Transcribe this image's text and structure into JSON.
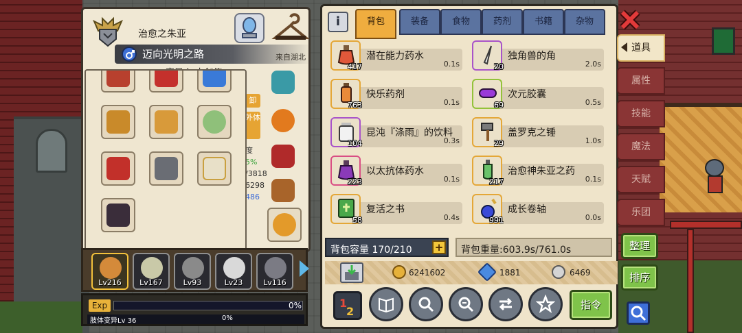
{
  "character": {
    "name": "治愈之朱亚",
    "title": "迈向光明之路",
    "origin": "来自湖北",
    "subtitle": "变异人 大剑使"
  },
  "stats_peek": {
    "btn1": "卸",
    "btn2": "外体",
    "lines": [
      "度",
      "5%",
      "/3818",
      "6298",
      "486"
    ]
  },
  "heroes": [
    {
      "level": "Lv216",
      "color": "#d48a3a"
    },
    {
      "level": "Lv167",
      "color": "#c9c9a8"
    },
    {
      "level": "Lv93",
      "color": "#8a8a8a"
    },
    {
      "level": "Lv23",
      "color": "#d9d9d9"
    },
    {
      "level": "Lv116",
      "color": "#7b7b84"
    }
  ],
  "exp": {
    "tag": "Exp",
    "percent": "0%",
    "sub_label": "肢体变异Lv 36",
    "sub_percent": "0%",
    "fill": 0
  },
  "tabs": [
    "背包",
    "装备",
    "食物",
    "药剂",
    "书籍",
    "杂物"
  ],
  "active_tab": "背包",
  "items": [
    {
      "name": "潜在能力药水",
      "count": "417",
      "time": "0.1s",
      "frame": "orange",
      "icon": "potion-orange-icon"
    },
    {
      "name": "独角兽的角",
      "count": "20",
      "time": "2.0s",
      "frame": "purple",
      "icon": "unicorn-horn-icon"
    },
    {
      "name": "快乐药剂",
      "count": "763",
      "time": "0.1s",
      "frame": "orange",
      "icon": "potion-bottle-icon"
    },
    {
      "name": "次元胶囊",
      "count": "69",
      "time": "0.5s",
      "frame": "green",
      "icon": "capsule-icon"
    },
    {
      "name": "昆沌『涤雨』的饮料",
      "count": "104",
      "time": "0.3s",
      "frame": "purple",
      "icon": "drink-jar-icon"
    },
    {
      "name": "盖罗克之锤",
      "count": "29",
      "time": "1.0s",
      "frame": "orange",
      "icon": "hammer-icon"
    },
    {
      "name": "以太抗体药水",
      "count": "223",
      "time": "0.1s",
      "frame": "pink",
      "icon": "potion-purple-icon"
    },
    {
      "name": "治愈神朱亚之药",
      "count": "217",
      "time": "0.1s",
      "frame": "orange",
      "icon": "potion-green-icon"
    },
    {
      "name": "复活之书",
      "count": "58",
      "time": "0.4s",
      "frame": "orange",
      "icon": "book-icon"
    },
    {
      "name": "成长卷轴",
      "count": "991",
      "time": "0.0s",
      "frame": "orange",
      "icon": "scroll-icon"
    }
  ],
  "capacity": "背包容量 170/210",
  "weight": "背包重量:603.9s/761.0s",
  "currency": {
    "gold": "6241602",
    "gem": "1881",
    "silver": "6469"
  },
  "command_label": "指令",
  "side_menu": [
    "道具",
    "属性",
    "技能",
    "魔法",
    "天赋",
    "乐团"
  ],
  "side_active": "道具",
  "side_buttons": {
    "sort1": "整理",
    "sort2": "排序"
  },
  "colors": {
    "accent_orange": "#efad3f",
    "tab_blue": "#5b73a0",
    "command_green": "#7fc34a",
    "side_red": "#8a3535"
  }
}
